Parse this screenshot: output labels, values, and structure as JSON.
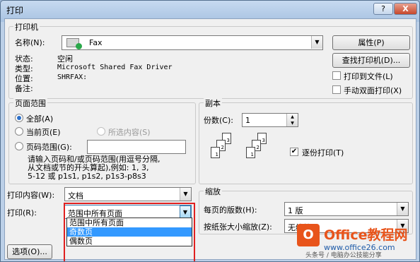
{
  "window": {
    "title": "打印",
    "help_label": "?",
    "close_label": "X"
  },
  "printer": {
    "group_title": "打印机",
    "name_label": "名称(N):",
    "name_value": "Fax",
    "status_label": "状态:",
    "status_value": "空闲",
    "type_label": "类型:",
    "type_value": "Microsoft Shared Fax Driver",
    "location_label": "位置:",
    "location_value": "SHRFAX:",
    "comment_label": "备注:",
    "properties_button": "属性(P)",
    "find_printer_button": "查找打印机(D)...",
    "print_to_file_label": "打印到文件(L)",
    "manual_duplex_label": "手动双面打印(X)"
  },
  "page_range": {
    "group_title": "页面范围",
    "all_label": "全部(A)",
    "current_label": "当前页(E)",
    "selection_label": "所选内容(S)",
    "pages_label": "页码范围(G):",
    "pages_value": "",
    "hint_line1": "请输入页码和/或页码范围(用逗号分隔,",
    "hint_line2": "从文档或节的开头算起),例如: 1, 3,",
    "hint_line3": "5-12 或 p1s1, p1s2, p1s3-p8s3",
    "selected": "all"
  },
  "copies": {
    "group_title": "副本",
    "count_label": "份数(C):",
    "count_value": "1",
    "collate_label": "逐份打印(T)",
    "collate_checked": true,
    "page_numbers_a": [
      "1",
      "2",
      "3"
    ],
    "page_numbers_b": [
      "1",
      "2",
      "3"
    ]
  },
  "print_what": {
    "label": "打印内容(W):",
    "value": "文档"
  },
  "print": {
    "label": "打印(R):",
    "value": "范围中所有页面",
    "options": [
      "范围中所有页面",
      "奇数页",
      "偶数页"
    ],
    "highlighted_index": 1
  },
  "zoom": {
    "group_title": "缩放",
    "pages_per_sheet_label": "每页的版数(H):",
    "pages_per_sheet_value": "1 版",
    "scale_label": "按纸张大小缩放(Z):",
    "scale_value": "无缩放"
  },
  "options_button": "选项(O)...",
  "watermark": {
    "logo_glyph": "O",
    "title": "Office教程网",
    "url": "www.office26.com",
    "note": "头条号 / 电脑办公技能分享",
    "accent_color": "#e8541b"
  }
}
